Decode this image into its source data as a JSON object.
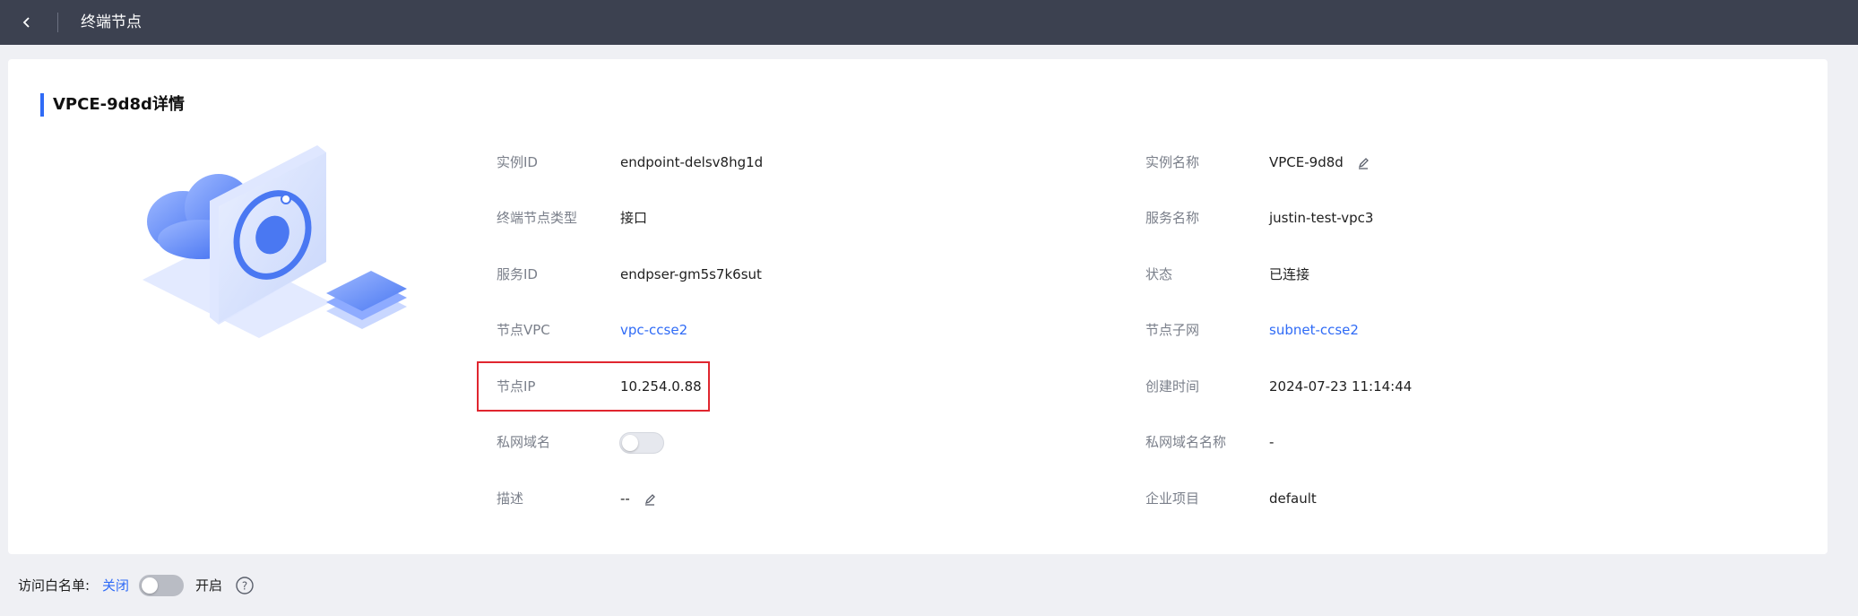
{
  "topbar": {
    "title": "终端节点"
  },
  "card": {
    "title": "VPCE-9d8d详情",
    "left_fields": [
      {
        "label": "实例ID",
        "value": "endpoint-delsv8hg1d"
      },
      {
        "label": "终端节点类型",
        "value": "接口"
      },
      {
        "label": "服务ID",
        "value": "endpser-gm5s7k6sut"
      },
      {
        "label": "节点VPC",
        "value": "vpc-ccse2"
      },
      {
        "label": "节点IP",
        "value": "10.254.0.88"
      },
      {
        "label": "私网域名",
        "value": ""
      },
      {
        "label": "描述",
        "value": "--"
      }
    ],
    "right_fields": [
      {
        "label": "实例名称",
        "value": "VPCE-9d8d"
      },
      {
        "label": "服务名称",
        "value": "justin-test-vpc3"
      },
      {
        "label": "状态",
        "value": "已连接"
      },
      {
        "label": "节点子网",
        "value": "subnet-ccse2"
      },
      {
        "label": "创建时间",
        "value": "2024-07-23 11:14:44"
      },
      {
        "label": "私网域名名称",
        "value": "-"
      },
      {
        "label": "企业项目",
        "value": "default"
      }
    ],
    "private_dns_enabled": false
  },
  "whitelist": {
    "label": "访问白名单:",
    "status": "关闭",
    "open_label": "开启",
    "enabled": false
  },
  "colors": {
    "accent": "#2f6bf6",
    "topbar": "#3c4150",
    "highlight": "#e0262f"
  },
  "icons": [
    "back-arrow-icon",
    "edit-icon",
    "help-icon"
  ]
}
